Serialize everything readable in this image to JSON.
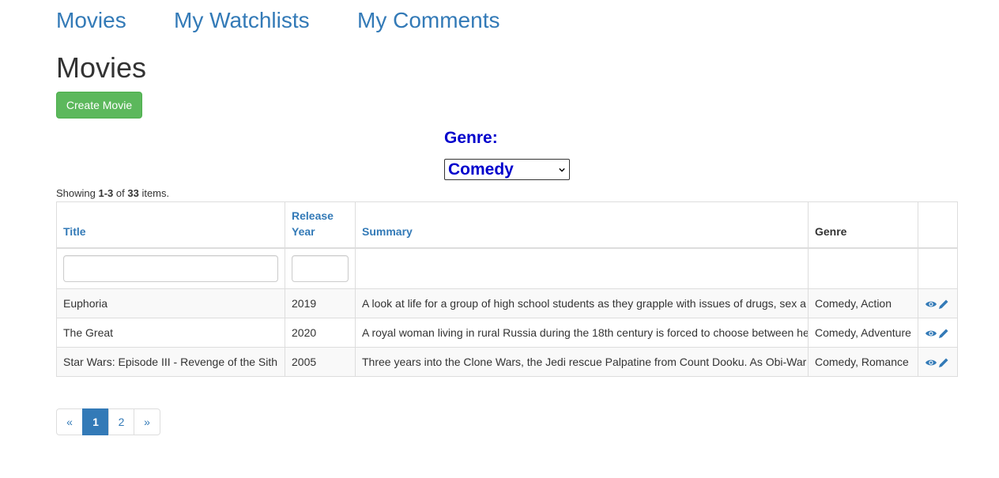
{
  "nav": {
    "movies": "Movies",
    "watchlists": "My Watchlists",
    "comments": "My Comments"
  },
  "page_title": "Movies",
  "create_button": "Create Movie",
  "filter": {
    "genre_label": "Genre:",
    "genre_selected": "Comedy"
  },
  "summary": {
    "prefix": "Showing ",
    "range": "1-3",
    "of": " of ",
    "total": "33",
    "suffix": " items."
  },
  "table": {
    "headers": {
      "title": "Title",
      "release_year_line1": "Release",
      "release_year_line2": "Year",
      "summary": "Summary",
      "genre": "Genre"
    },
    "rows": [
      {
        "title": "Euphoria",
        "year": "2019",
        "summary": "A look at life for a group of high school students as they grapple with issues of drugs, sex a",
        "genre": "Comedy, Action"
      },
      {
        "title": "The Great",
        "year": "2020",
        "summary": "A royal woman living in rural Russia during the 18th century is forced to choose between he",
        "genre": "Comedy, Adventure"
      },
      {
        "title": "Star Wars: Episode III - Revenge of the Sith",
        "year": "2005",
        "summary": "Three years into the Clone Wars, the Jedi rescue Palpatine from Count Dooku. As Obi-War",
        "genre": "Comedy, Romance"
      }
    ]
  },
  "pagination": {
    "prev": "«",
    "pages": [
      "1",
      "2"
    ],
    "next": "»",
    "active_page": "1"
  },
  "colors": {
    "link": "#337ab7",
    "success": "#5cb85c",
    "genre_accent": "#0000cc"
  },
  "icons": {
    "view": "eye-icon",
    "edit": "pencil-icon",
    "dropdown": "chevron-down-icon"
  }
}
